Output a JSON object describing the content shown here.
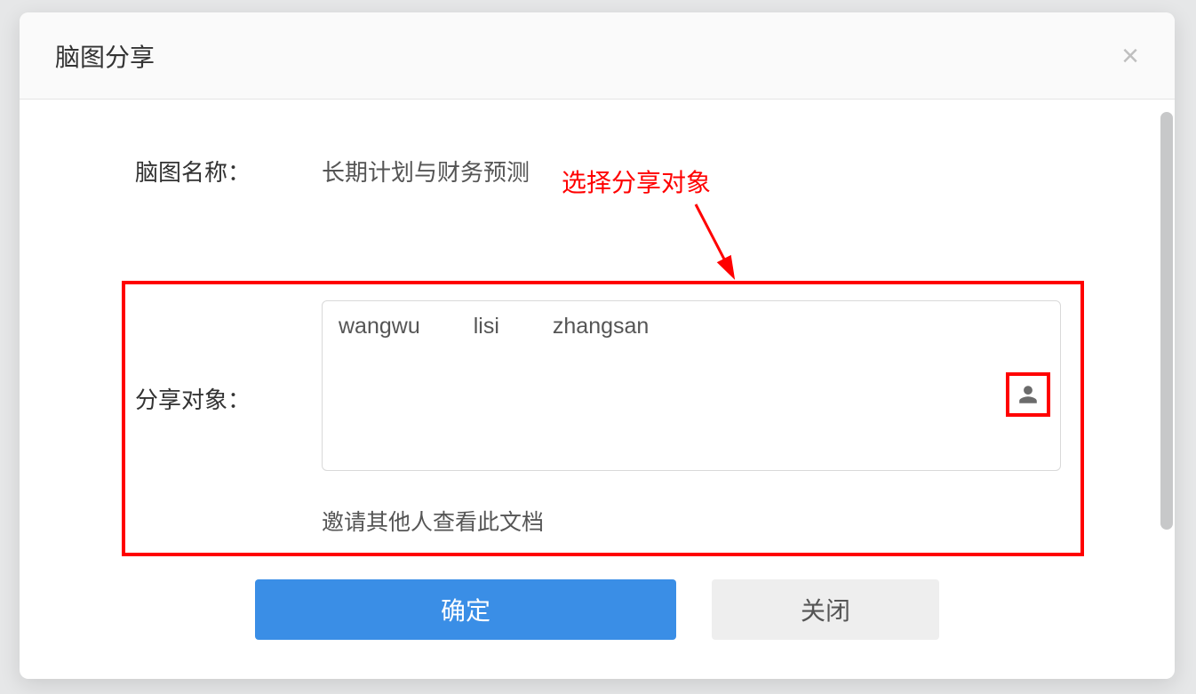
{
  "dialog": {
    "title": "脑图分享",
    "close_glyph": "×"
  },
  "form": {
    "name_label": "脑图名称：",
    "name_value": "长期计划与财务预测",
    "share_label": "分享对象：",
    "share_users": [
      "wangwu",
      "lisi",
      "zhangsan"
    ],
    "share_hint": "邀请其他人查看此文档"
  },
  "annotation": {
    "text": "选择分享对象"
  },
  "buttons": {
    "ok": "确定",
    "close": "关闭"
  }
}
